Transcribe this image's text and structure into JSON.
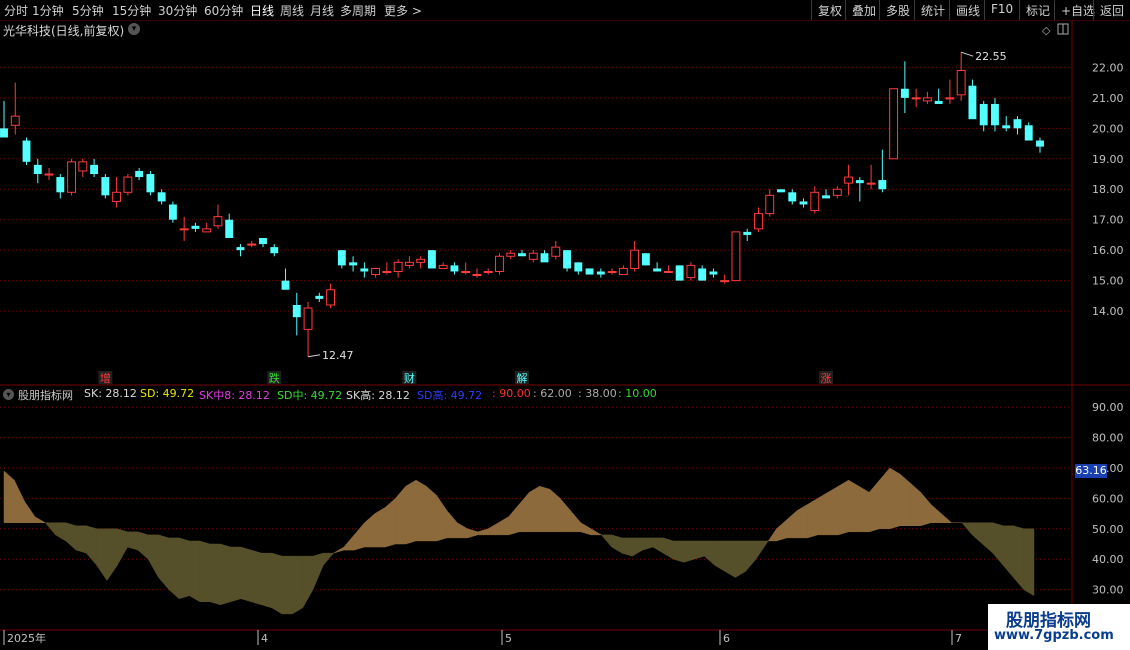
{
  "toolbar": {
    "periods": [
      "分时",
      "1分钟",
      "5分钟",
      "15分钟",
      "30分钟",
      "60分钟",
      "日线",
      "周线",
      "月线",
      "多周期",
      "更多 >"
    ],
    "active_period": "日线",
    "right_buttons": [
      "复权",
      "叠加",
      "多股",
      "统计",
      "画线",
      "F10",
      "标记",
      "+自选",
      "返回"
    ]
  },
  "stock": {
    "title": "光华科技(日线,前复权)"
  },
  "indicator": {
    "name": "股朋指标网",
    "values": [
      {
        "label": "SK: 28.12",
        "color": "#d8d8d8"
      },
      {
        "label": "SD: 49.72",
        "color": "#e6e600"
      },
      {
        "label": "SK中8: 28.12",
        "color": "#e040e0"
      },
      {
        "label": "SD中: 49.72",
        "color": "#33dd33"
      },
      {
        "label": "SK高: 28.12",
        "color": "#d8d8d8"
      },
      {
        "label": "SD高: 49.72",
        "color": "#2a3fff"
      },
      {
        "label": ": 90.00",
        "color": "#ff3030"
      },
      {
        "label": ": 62.00",
        "color": "#aaaaaa"
      },
      {
        "label": ": 38.00",
        "color": "#aaaaaa"
      },
      {
        "label": ": 10.00",
        "color": "#33dd33"
      }
    ],
    "current_value": "63.16"
  },
  "watermark": {
    "line1": "股朋指标网",
    "line2": "www.7gpzb.com"
  },
  "colors": {
    "up": "#ff3c3c",
    "down": "#54ffff",
    "grid": "#7a0000",
    "fill_up": "#8c6a3c",
    "fill_down": "#56502a"
  },
  "chart_data": [
    {
      "type": "candlestick",
      "title": "光华科技(日线,前复权)",
      "ylim": [
        12.0,
        22.9
      ],
      "y_ticks": [
        "22.00",
        "21.00",
        "20.00",
        "19.00",
        "18.00",
        "17.00",
        "16.00",
        "15.00",
        "14.00"
      ],
      "x_ticks": [
        "2025年",
        "4",
        "5",
        "6",
        "7"
      ],
      "annotations": [
        {
          "label": "22.55",
          "kind": "high"
        },
        {
          "label": "12.47",
          "kind": "low"
        }
      ],
      "event_markers": [
        {
          "label": "增",
          "color": "#ff3c3c",
          "bar": 9
        },
        {
          "label": "跌",
          "color": "#33dd33",
          "bar": 24
        },
        {
          "label": "财",
          "color": "#54ffff",
          "bar": 36
        },
        {
          "label": "解",
          "color": "#54ffff",
          "bar": 46
        },
        {
          "label": "涨",
          "color": "#ff3c3c",
          "bar": 73
        }
      ],
      "candles": [
        [
          20.0,
          20.9,
          19.7,
          19.7
        ],
        [
          20.1,
          21.5,
          19.8,
          20.4
        ],
        [
          19.6,
          19.7,
          18.8,
          18.9
        ],
        [
          18.8,
          19.0,
          18.2,
          18.5
        ],
        [
          18.5,
          18.7,
          18.3,
          18.5
        ],
        [
          18.4,
          18.5,
          17.7,
          17.9
        ],
        [
          17.9,
          19.0,
          17.8,
          18.9
        ],
        [
          18.6,
          19.0,
          18.4,
          18.9
        ],
        [
          18.8,
          19.0,
          18.4,
          18.5
        ],
        [
          18.4,
          18.5,
          17.7,
          17.8
        ],
        [
          17.6,
          18.4,
          17.4,
          17.9
        ],
        [
          17.9,
          18.5,
          17.8,
          18.4
        ],
        [
          18.6,
          18.7,
          18.3,
          18.4
        ],
        [
          18.5,
          18.6,
          17.8,
          17.9
        ],
        [
          17.9,
          18.0,
          17.5,
          17.6
        ],
        [
          17.5,
          17.6,
          16.9,
          17.0
        ],
        [
          16.7,
          17.1,
          16.3,
          16.7
        ],
        [
          16.8,
          16.9,
          16.6,
          16.7
        ],
        [
          16.6,
          16.9,
          16.6,
          16.7
        ],
        [
          16.8,
          17.5,
          16.7,
          17.1
        ],
        [
          17.0,
          17.2,
          16.4,
          16.4
        ],
        [
          16.1,
          16.2,
          15.8,
          16.0
        ],
        [
          16.2,
          16.3,
          16.1,
          16.2
        ],
        [
          16.4,
          16.4,
          16.1,
          16.2
        ],
        [
          16.1,
          16.2,
          15.8,
          15.9
        ],
        [
          15.0,
          15.4,
          14.8,
          14.7
        ],
        [
          14.2,
          14.6,
          13.2,
          13.8
        ],
        [
          13.4,
          14.3,
          12.5,
          14.1
        ],
        [
          14.5,
          14.6,
          14.3,
          14.4
        ],
        [
          14.2,
          14.9,
          14.1,
          14.7
        ],
        [
          16.0,
          16.0,
          15.4,
          15.5
        ],
        [
          15.6,
          15.8,
          15.3,
          15.5
        ],
        [
          15.4,
          15.6,
          15.1,
          15.3
        ],
        [
          15.2,
          15.4,
          15.1,
          15.4
        ],
        [
          15.3,
          15.6,
          15.2,
          15.3
        ],
        [
          15.3,
          15.7,
          15.1,
          15.6
        ],
        [
          15.5,
          15.8,
          15.4,
          15.6
        ],
        [
          15.6,
          15.8,
          15.4,
          15.7
        ],
        [
          16.0,
          16.0,
          15.4,
          15.4
        ],
        [
          15.4,
          15.6,
          15.4,
          15.5
        ],
        [
          15.5,
          15.6,
          15.2,
          15.3
        ],
        [
          15.3,
          15.6,
          15.2,
          15.3
        ],
        [
          15.2,
          15.4,
          15.1,
          15.2
        ],
        [
          15.3,
          15.4,
          15.2,
          15.3
        ],
        [
          15.3,
          15.9,
          15.2,
          15.8
        ],
        [
          15.8,
          16.0,
          15.7,
          15.9
        ],
        [
          15.9,
          16.0,
          15.8,
          15.8
        ],
        [
          15.7,
          16.0,
          15.6,
          15.9
        ],
        [
          15.9,
          16.0,
          15.6,
          15.6
        ],
        [
          15.8,
          16.3,
          15.7,
          16.1
        ],
        [
          16.0,
          16.0,
          15.3,
          15.4
        ],
        [
          15.6,
          15.6,
          15.2,
          15.3
        ],
        [
          15.4,
          15.4,
          15.2,
          15.2
        ],
        [
          15.3,
          15.4,
          15.1,
          15.2
        ],
        [
          15.3,
          15.4,
          15.2,
          15.3
        ],
        [
          15.2,
          15.5,
          15.2,
          15.4
        ],
        [
          15.4,
          16.3,
          15.3,
          16.0
        ],
        [
          15.9,
          15.9,
          15.5,
          15.5
        ],
        [
          15.4,
          15.6,
          15.3,
          15.3
        ],
        [
          15.3,
          15.5,
          15.3,
          15.3
        ],
        [
          15.5,
          15.5,
          15.1,
          15.0
        ],
        [
          15.1,
          15.6,
          15.0,
          15.5
        ],
        [
          15.4,
          15.5,
          15.0,
          15.0
        ],
        [
          15.3,
          15.4,
          15.1,
          15.2
        ],
        [
          15.0,
          15.2,
          14.9,
          15.0
        ],
        [
          15.0,
          16.6,
          15.0,
          16.6
        ],
        [
          16.6,
          16.7,
          16.3,
          16.5
        ],
        [
          16.7,
          17.4,
          16.6,
          17.2
        ],
        [
          17.2,
          18.0,
          17.1,
          17.8
        ],
        [
          18.0,
          18.0,
          17.9,
          17.9
        ],
        [
          17.9,
          18.0,
          17.5,
          17.6
        ],
        [
          17.6,
          17.7,
          17.4,
          17.5
        ],
        [
          17.3,
          18.1,
          17.2,
          17.9
        ],
        [
          17.8,
          18.0,
          17.7,
          17.7
        ],
        [
          17.8,
          18.1,
          17.7,
          18.0
        ],
        [
          18.2,
          18.8,
          17.8,
          18.4
        ],
        [
          18.3,
          18.4,
          17.6,
          18.2
        ],
        [
          18.2,
          18.8,
          18.0,
          18.2
        ],
        [
          18.3,
          19.3,
          17.9,
          18.0
        ],
        [
          19.0,
          21.3,
          19.2,
          21.3
        ],
        [
          21.3,
          22.2,
          20.5,
          21.0
        ],
        [
          21.0,
          21.3,
          20.7,
          21.0
        ],
        [
          20.9,
          21.2,
          20.8,
          21.0
        ],
        [
          20.9,
          21.3,
          20.8,
          20.8
        ],
        [
          21.0,
          21.6,
          20.8,
          21.0
        ],
        [
          21.1,
          22.5,
          20.9,
          21.9
        ],
        [
          21.4,
          21.6,
          20.5,
          20.3
        ],
        [
          20.8,
          20.9,
          19.9,
          20.1
        ],
        [
          20.8,
          21.0,
          19.9,
          20.1
        ],
        [
          20.1,
          20.4,
          19.9,
          20.0
        ],
        [
          20.3,
          20.4,
          19.8,
          20.0
        ],
        [
          20.1,
          20.2,
          19.8,
          19.6
        ],
        [
          19.6,
          19.7,
          19.2,
          19.4
        ]
      ]
    },
    {
      "type": "area",
      "title": "股朋指标网",
      "ylim": [
        20,
        95
      ],
      "y_ticks": [
        "90.00",
        "80.00",
        "70.00",
        "60.00",
        "50.00",
        "40.00",
        "30.00"
      ],
      "reference_lines": [
        90,
        62,
        38,
        10
      ],
      "series": [
        {
          "name": "SK",
          "values": [
            69,
            66,
            59,
            54,
            52,
            48,
            46,
            43,
            42,
            38,
            33,
            38,
            44,
            43,
            40,
            34,
            30,
            27,
            28,
            26,
            26,
            25,
            26,
            27,
            26,
            25,
            24,
            22,
            22,
            24,
            30,
            38,
            42,
            44,
            48,
            52,
            55,
            57,
            60,
            64,
            66,
            64,
            61,
            56,
            52,
            50,
            49,
            50,
            52,
            54,
            58,
            62,
            64,
            63,
            60,
            56,
            52,
            50,
            48,
            44,
            42,
            41,
            43,
            44,
            42,
            40,
            39,
            40,
            41,
            38,
            36,
            34,
            36,
            40,
            45,
            50,
            53,
            56,
            58,
            60,
            62,
            64,
            66,
            64,
            62,
            66,
            70,
            68,
            65,
            62,
            58,
            55,
            52,
            52,
            48,
            45,
            42,
            38,
            34,
            30,
            28
          ]
        },
        {
          "name": "SD",
          "values": [
            52,
            52,
            52,
            52,
            52,
            52,
            52,
            51,
            51,
            50,
            50,
            50,
            49,
            49,
            48,
            48,
            47,
            47,
            46,
            46,
            45,
            45,
            44,
            44,
            43,
            42,
            42,
            41,
            41,
            41,
            41,
            42,
            42,
            43,
            43,
            44,
            44,
            44,
            45,
            45,
            46,
            46,
            46,
            47,
            47,
            47,
            48,
            48,
            48,
            48,
            49,
            49,
            49,
            49,
            49,
            49,
            49,
            48,
            48,
            48,
            47,
            47,
            47,
            47,
            47,
            46,
            46,
            46,
            46,
            46,
            46,
            46,
            46,
            46,
            46,
            46,
            47,
            47,
            47,
            48,
            48,
            48,
            49,
            49,
            49,
            50,
            50,
            51,
            51,
            51,
            52,
            52,
            52,
            52,
            52,
            52,
            52,
            51,
            51,
            50,
            50
          ]
        }
      ]
    }
  ]
}
